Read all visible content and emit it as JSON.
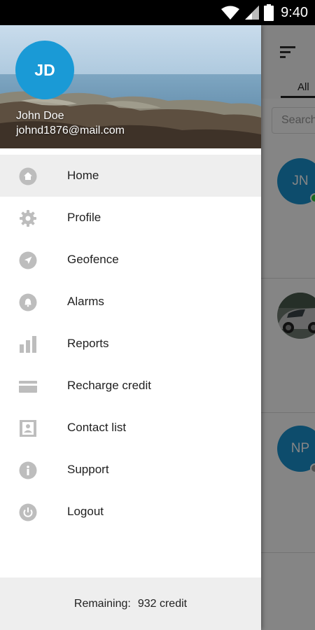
{
  "status_bar": {
    "time": "9:40",
    "icons": [
      "wifi-icon",
      "signal-icon",
      "battery-icon"
    ]
  },
  "drawer": {
    "header": {
      "avatar_initials": "JD",
      "user_name": "John Doe",
      "user_email": "johnd1876@mail.com"
    },
    "menu": [
      {
        "label": "Home",
        "icon": "home-icon",
        "active": true
      },
      {
        "label": "Profile",
        "icon": "gear-icon",
        "active": false
      },
      {
        "label": "Geofence",
        "icon": "navigation-icon",
        "active": false
      },
      {
        "label": "Alarms",
        "icon": "bell-icon",
        "active": false
      },
      {
        "label": "Reports",
        "icon": "bar-chart-icon",
        "active": false
      },
      {
        "label": "Recharge credit",
        "icon": "credit-card-icon",
        "active": false
      },
      {
        "label": "Contact list",
        "icon": "contact-card-icon",
        "active": false
      },
      {
        "label": "Support",
        "icon": "info-icon",
        "active": false
      },
      {
        "label": "Logout",
        "icon": "power-icon",
        "active": false
      }
    ],
    "footer": {
      "label": "Remaining:",
      "value": "932 credit"
    }
  },
  "background_app": {
    "tab_all": "All",
    "search_placeholder": "Search",
    "rows": [
      {
        "initials": "JN",
        "online": true
      },
      {
        "initials": "",
        "is_car_photo": true
      },
      {
        "initials": "NP",
        "online": false
      }
    ]
  },
  "colors": {
    "accent": "#1a9ad6",
    "online": "#2ecc40",
    "icon_gray": "#bdbdbd"
  }
}
